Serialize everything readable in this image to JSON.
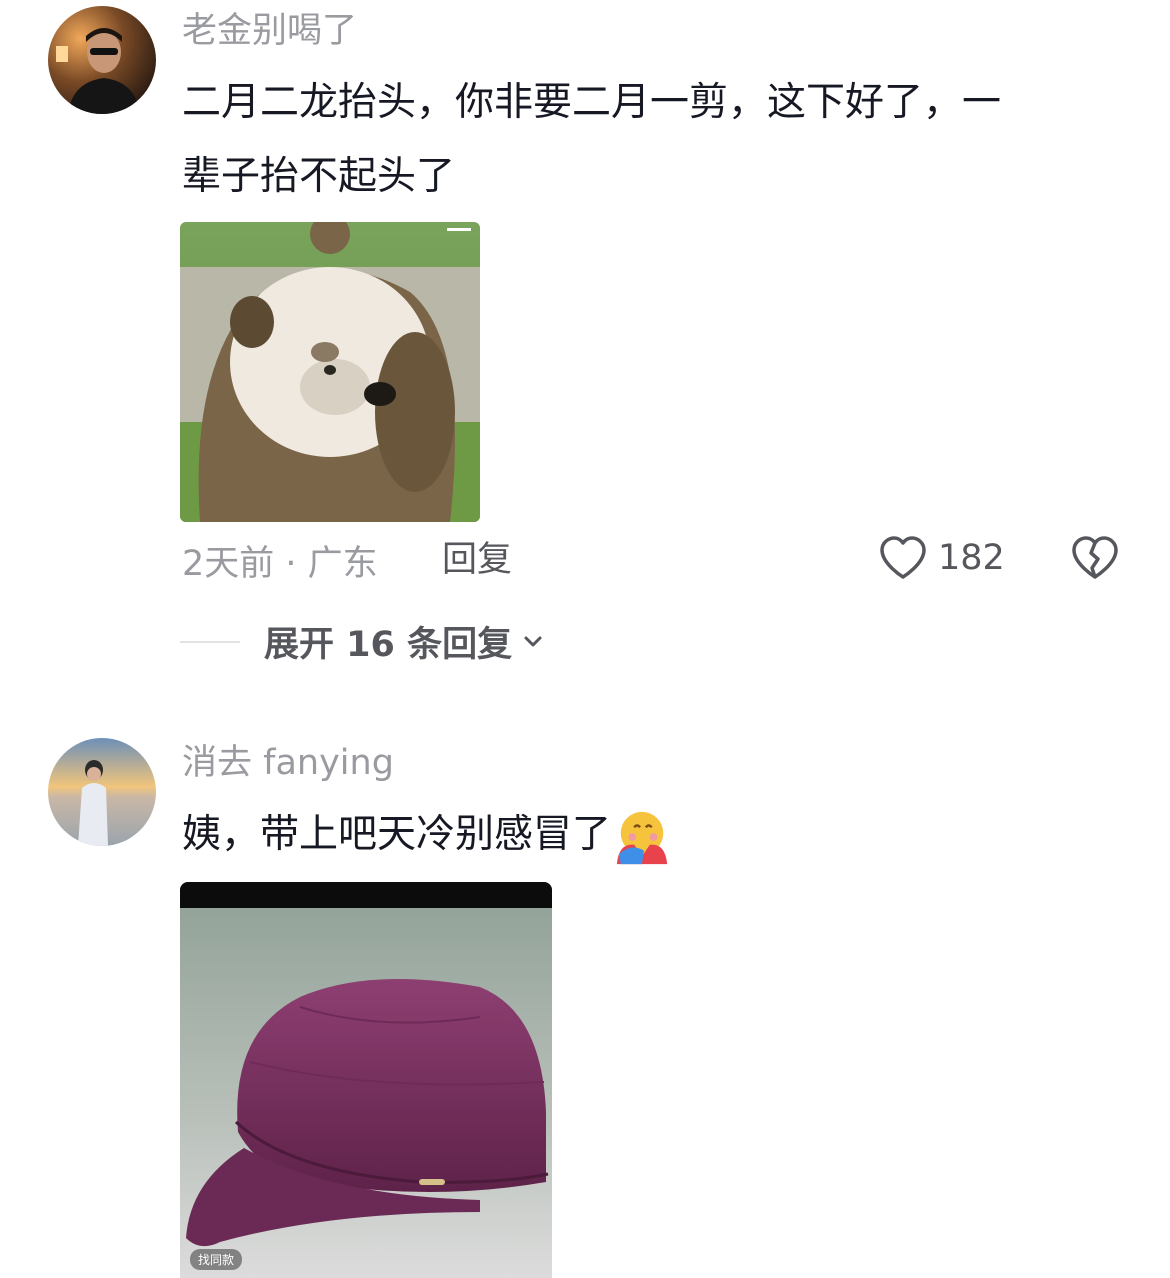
{
  "comments": [
    {
      "username": "老金别喝了",
      "text": "二月二龙抬头，你非要二月一剪，这下好了，一辈子抬不起头了",
      "text_line1": "二月二龙抬头，你非要二月一剪，这下好了，一",
      "text_line2": "辈子抬不起头了",
      "meta": "2天前 · 广东",
      "reply_label": "回复",
      "like_count": "182",
      "expand_label": "展开 16 条回复"
    },
    {
      "username": "消去 fanying",
      "text": "姨，带上吧天冷别感冒了",
      "image_badge": "找同款"
    }
  ],
  "icons": [
    "heart-icon",
    "broken-heart-icon",
    "chevron-down-icon",
    "hug-emoji-icon"
  ]
}
